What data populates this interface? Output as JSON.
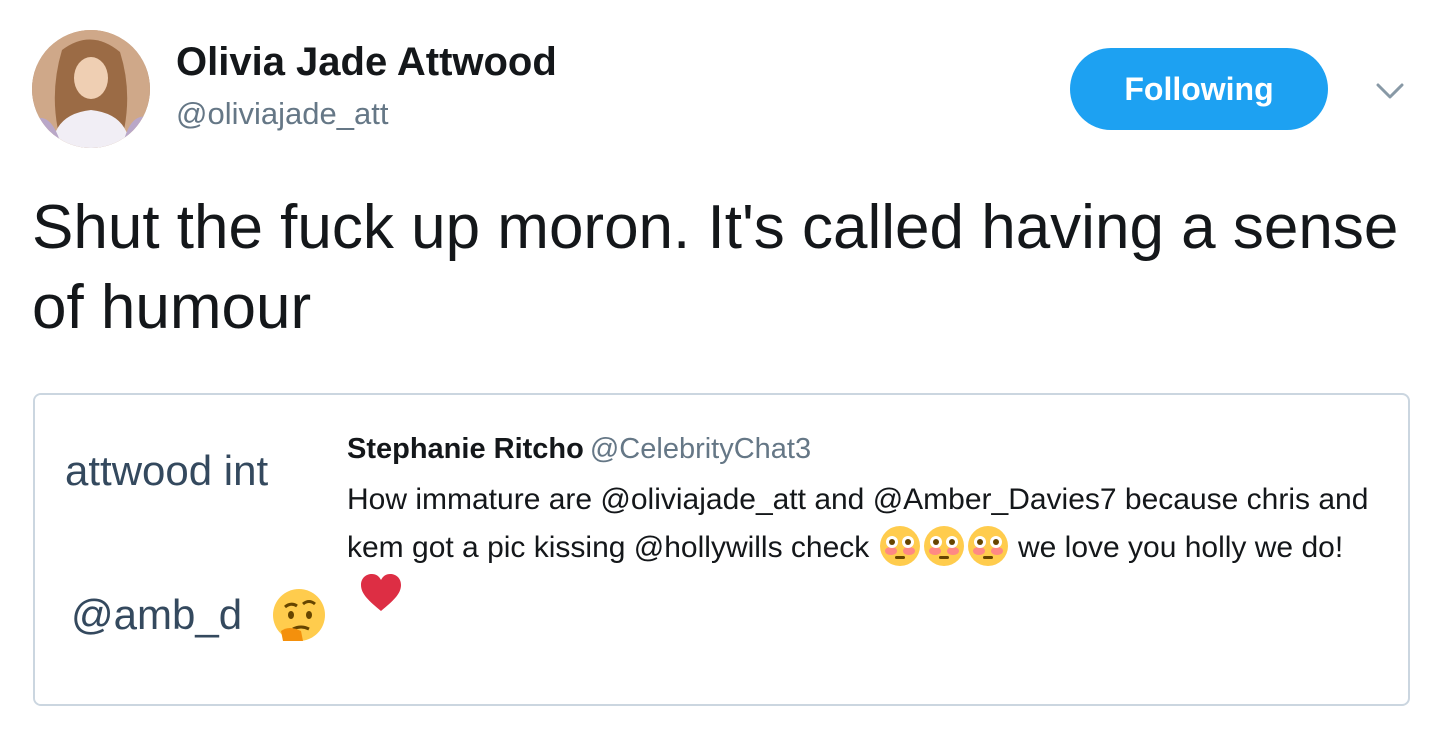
{
  "author": {
    "name": "Olivia Jade Attwood",
    "handle": "@oliviajade_att"
  },
  "follow_button": {
    "label": "Following"
  },
  "tweet": {
    "text": "Shut the fuck up moron. It's called having a sense of humour"
  },
  "quoted_tweet": {
    "author_name": "Stephanie Ritcho",
    "author_handle": "@CelebrityChat3",
    "text_part1": "How immature are @oliviajade_att and @Amber_Davies7 because chris and kem got a pic kissing @hollywills check ",
    "text_part2": " we love you holly we do!",
    "media": {
      "line1": "attwood int",
      "line2": "@amb_d"
    }
  },
  "icons": {
    "caret": "chevron-down-icon",
    "flushed_emoji": "flushed-face-emoji",
    "heart": "red-heart-emoji",
    "thinking_emoji": "thinking-face-emoji"
  },
  "colors": {
    "accent": "#1da1f2",
    "text": "#14171a",
    "muted": "#657786",
    "border": "#cbd6e0"
  }
}
